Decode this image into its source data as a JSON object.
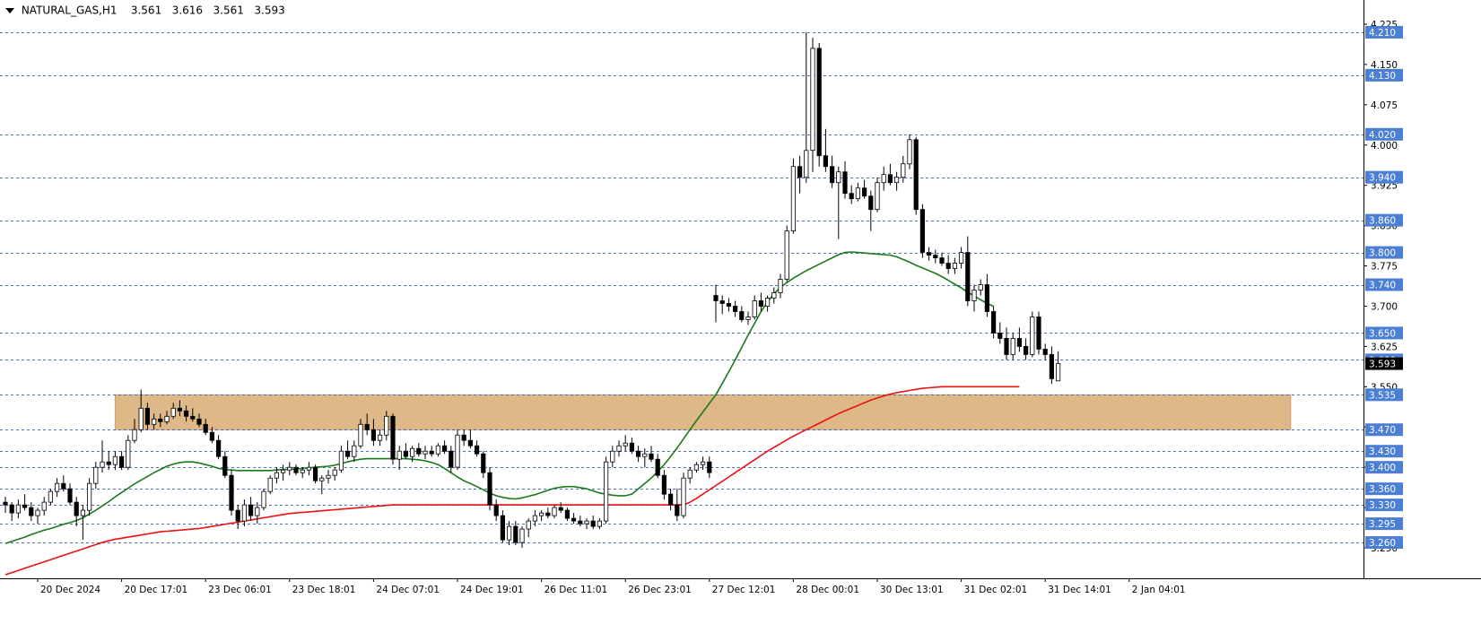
{
  "header": {
    "symbol": "NATURAL_GAS,H1",
    "open": "3.561",
    "high": "3.616",
    "low": "3.561",
    "close": "3.593"
  },
  "chart_data": {
    "type": "candlestick",
    "y_range": [
      3.215,
      4.245
    ],
    "price_axis_ticks": [
      4.225,
      4.15,
      4.075,
      4.0,
      3.925,
      3.85,
      3.775,
      3.7,
      3.625,
      3.55,
      3.475,
      3.4,
      3.325,
      3.25
    ],
    "horizontal_levels": [
      {
        "value": 4.21,
        "label": "4.210"
      },
      {
        "value": 4.13,
        "label": "4.130"
      },
      {
        "value": 4.02,
        "label": "4.020"
      },
      {
        "value": 3.94,
        "label": "3.940"
      },
      {
        "value": 3.86,
        "label": "3.860"
      },
      {
        "value": 3.8,
        "label": "3.800"
      },
      {
        "value": 3.74,
        "label": "3.740"
      },
      {
        "value": 3.65,
        "label": "3.650"
      },
      {
        "value": 3.6,
        "label": "3.600"
      },
      {
        "value": 3.535,
        "label": "3.535"
      },
      {
        "value": 3.47,
        "label": "3.470"
      },
      {
        "value": 3.43,
        "label": "3.430"
      },
      {
        "value": 3.4,
        "label": "3.400"
      },
      {
        "value": 3.36,
        "label": "3.360"
      },
      {
        "value": 3.33,
        "label": "3.330"
      },
      {
        "value": 3.295,
        "label": "3.295"
      },
      {
        "value": 3.26,
        "label": "3.260"
      }
    ],
    "current_price": {
      "value": 3.593,
      "label": "3.593"
    },
    "zone": {
      "low": 3.47,
      "high": 3.535,
      "start_bar": 17,
      "end_bar": 199,
      "color": "#deb887"
    },
    "time_labels": [
      {
        "bar": 5,
        "label": "20 Dec 2024"
      },
      {
        "bar": 18,
        "label": "20 Dec 17:01"
      },
      {
        "bar": 31,
        "label": "23 Dec 06:01"
      },
      {
        "bar": 44,
        "label": "23 Dec 18:01"
      },
      {
        "bar": 57,
        "label": "24 Dec 07:01"
      },
      {
        "bar": 70,
        "label": "24 Dec 19:01"
      },
      {
        "bar": 83,
        "label": "26 Dec 11:01"
      },
      {
        "bar": 96,
        "label": "26 Dec 23:01"
      },
      {
        "bar": 109,
        "label": "27 Dec 12:01"
      },
      {
        "bar": 122,
        "label": "28 Dec 00:01"
      },
      {
        "bar": 135,
        "label": "30 Dec 13:01"
      },
      {
        "bar": 148,
        "label": "31 Dec 02:01"
      },
      {
        "bar": 161,
        "label": "31 Dec 14:01"
      },
      {
        "bar": 174,
        "label": "2 Jan 04:01"
      }
    ],
    "ohlc": [
      [
        3.335,
        3.345,
        3.315,
        3.33
      ],
      [
        3.33,
        3.335,
        3.3,
        3.315
      ],
      [
        3.315,
        3.34,
        3.305,
        3.33
      ],
      [
        3.33,
        3.35,
        3.32,
        3.325
      ],
      [
        3.325,
        3.335,
        3.3,
        3.31
      ],
      [
        3.31,
        3.325,
        3.295,
        3.32
      ],
      [
        3.32,
        3.345,
        3.31,
        3.335
      ],
      [
        3.335,
        3.36,
        3.33,
        3.355
      ],
      [
        3.355,
        3.38,
        3.345,
        3.37
      ],
      [
        3.37,
        3.385,
        3.355,
        3.36
      ],
      [
        3.36,
        3.37,
        3.33,
        3.335
      ],
      [
        3.335,
        3.345,
        3.29,
        3.31
      ],
      [
        3.31,
        3.33,
        3.265,
        3.32
      ],
      [
        3.32,
        3.38,
        3.31,
        3.37
      ],
      [
        3.37,
        3.41,
        3.36,
        3.4
      ],
      [
        3.4,
        3.45,
        3.39,
        3.41
      ],
      [
        3.41,
        3.43,
        3.395,
        3.405
      ],
      [
        3.405,
        3.43,
        3.395,
        3.42
      ],
      [
        3.42,
        3.43,
        3.395,
        3.4
      ],
      [
        3.4,
        3.46,
        3.395,
        3.45
      ],
      [
        3.45,
        3.49,
        3.445,
        3.47
      ],
      [
        3.47,
        3.545,
        3.465,
        3.51
      ],
      [
        3.51,
        3.52,
        3.47,
        3.48
      ],
      [
        3.48,
        3.5,
        3.47,
        3.49
      ],
      [
        3.49,
        3.5,
        3.475,
        3.485
      ],
      [
        3.485,
        3.505,
        3.48,
        3.495
      ],
      [
        3.495,
        3.52,
        3.49,
        3.51
      ],
      [
        3.51,
        3.525,
        3.495,
        3.505
      ],
      [
        3.505,
        3.515,
        3.485,
        3.495
      ],
      [
        3.495,
        3.51,
        3.485,
        3.49
      ],
      [
        3.49,
        3.5,
        3.475,
        3.48
      ],
      [
        3.48,
        3.49,
        3.46,
        3.465
      ],
      [
        3.465,
        3.475,
        3.445,
        3.45
      ],
      [
        3.45,
        3.46,
        3.415,
        3.42
      ],
      [
        3.42,
        3.43,
        3.38,
        3.385
      ],
      [
        3.385,
        3.395,
        3.31,
        3.32
      ],
      [
        3.32,
        3.33,
        3.285,
        3.3
      ],
      [
        3.3,
        3.34,
        3.29,
        3.33
      ],
      [
        3.33,
        3.345,
        3.3,
        3.31
      ],
      [
        3.31,
        3.335,
        3.295,
        3.325
      ],
      [
        3.325,
        3.36,
        3.32,
        3.355
      ],
      [
        3.355,
        3.385,
        3.35,
        3.38
      ],
      [
        3.38,
        3.4,
        3.37,
        3.39
      ],
      [
        3.39,
        3.405,
        3.375,
        3.395
      ],
      [
        3.395,
        3.41,
        3.385,
        3.4
      ],
      [
        3.4,
        3.405,
        3.385,
        3.39
      ],
      [
        3.39,
        3.4,
        3.38,
        3.395
      ],
      [
        3.395,
        3.41,
        3.385,
        3.4
      ],
      [
        3.4,
        3.405,
        3.37,
        3.375
      ],
      [
        3.375,
        3.385,
        3.35,
        3.38
      ],
      [
        3.38,
        3.395,
        3.37,
        3.385
      ],
      [
        3.385,
        3.4,
        3.375,
        3.395
      ],
      [
        3.395,
        3.44,
        3.39,
        3.43
      ],
      [
        3.43,
        3.45,
        3.415,
        3.42
      ],
      [
        3.42,
        3.45,
        3.41,
        3.44
      ],
      [
        3.44,
        3.49,
        3.435,
        3.48
      ],
      [
        3.48,
        3.5,
        3.46,
        3.47
      ],
      [
        3.47,
        3.49,
        3.44,
        3.45
      ],
      [
        3.45,
        3.47,
        3.44,
        3.46
      ],
      [
        3.46,
        3.505,
        3.45,
        3.495
      ],
      [
        3.495,
        3.5,
        3.405,
        3.415
      ],
      [
        3.415,
        3.44,
        3.395,
        3.43
      ],
      [
        3.43,
        3.445,
        3.415,
        3.42
      ],
      [
        3.42,
        3.44,
        3.41,
        3.435
      ],
      [
        3.435,
        3.445,
        3.42,
        3.425
      ],
      [
        3.425,
        3.44,
        3.415,
        3.43
      ],
      [
        3.43,
        3.44,
        3.42,
        3.425
      ],
      [
        3.425,
        3.445,
        3.42,
        3.44
      ],
      [
        3.44,
        3.45,
        3.425,
        3.43
      ],
      [
        3.43,
        3.44,
        3.39,
        3.4
      ],
      [
        3.4,
        3.47,
        3.395,
        3.46
      ],
      [
        3.46,
        3.47,
        3.44,
        3.45
      ],
      [
        3.45,
        3.47,
        3.435,
        3.44
      ],
      [
        3.44,
        3.45,
        3.42,
        3.425
      ],
      [
        3.425,
        3.43,
        3.38,
        3.39
      ],
      [
        3.39,
        3.4,
        3.32,
        3.33
      ],
      [
        3.33,
        3.34,
        3.3,
        3.31
      ],
      [
        3.31,
        3.32,
        3.26,
        3.265
      ],
      [
        3.265,
        3.3,
        3.255,
        3.29
      ],
      [
        3.29,
        3.3,
        3.255,
        3.26
      ],
      [
        3.26,
        3.29,
        3.25,
        3.285
      ],
      [
        3.285,
        3.305,
        3.27,
        3.3
      ],
      [
        3.3,
        3.32,
        3.29,
        3.31
      ],
      [
        3.31,
        3.32,
        3.3,
        3.315
      ],
      [
        3.315,
        3.325,
        3.305,
        3.31
      ],
      [
        3.31,
        3.33,
        3.305,
        3.325
      ],
      [
        3.325,
        3.335,
        3.315,
        3.32
      ],
      [
        3.32,
        3.325,
        3.3,
        3.305
      ],
      [
        3.305,
        3.315,
        3.295,
        3.3
      ],
      [
        3.3,
        3.31,
        3.29,
        3.295
      ],
      [
        3.295,
        3.305,
        3.285,
        3.3
      ],
      [
        3.3,
        3.31,
        3.285,
        3.29
      ],
      [
        3.29,
        3.305,
        3.285,
        3.3
      ],
      [
        3.3,
        3.42,
        3.295,
        3.41
      ],
      [
        3.41,
        3.44,
        3.4,
        3.43
      ],
      [
        3.43,
        3.45,
        3.42,
        3.44
      ],
      [
        3.44,
        3.46,
        3.43,
        3.445
      ],
      [
        3.445,
        3.455,
        3.425,
        3.43
      ],
      [
        3.43,
        3.44,
        3.41,
        3.42
      ],
      [
        3.42,
        3.435,
        3.4,
        3.425
      ],
      [
        3.425,
        3.44,
        3.41,
        3.415
      ],
      [
        3.415,
        3.425,
        3.38,
        3.385
      ],
      [
        3.385,
        3.395,
        3.34,
        3.35
      ],
      [
        3.35,
        3.36,
        3.32,
        3.33
      ],
      [
        3.33,
        3.36,
        3.3,
        3.31
      ],
      [
        3.31,
        3.39,
        3.305,
        3.38
      ],
      [
        3.38,
        3.4,
        3.37,
        3.395
      ],
      [
        3.395,
        3.41,
        3.39,
        3.405
      ],
      [
        3.405,
        3.42,
        3.395,
        3.41
      ],
      [
        3.41,
        3.42,
        3.38,
        3.39
      ],
      [
        3.72,
        3.74,
        3.67,
        3.71
      ],
      [
        3.71,
        3.72,
        3.685,
        3.705
      ],
      [
        3.705,
        3.715,
        3.69,
        3.7
      ],
      [
        3.7,
        3.71,
        3.68,
        3.69
      ],
      [
        3.69,
        3.7,
        3.67,
        3.675
      ],
      [
        3.675,
        3.69,
        3.665,
        3.68
      ],
      [
        3.68,
        3.72,
        3.675,
        3.71
      ],
      [
        3.71,
        3.725,
        3.69,
        3.7
      ],
      [
        3.7,
        3.72,
        3.69,
        3.715
      ],
      [
        3.715,
        3.735,
        3.705,
        3.725
      ],
      [
        3.725,
        3.76,
        3.715,
        3.75
      ],
      [
        3.75,
        3.85,
        3.745,
        3.84
      ],
      [
        3.84,
        3.975,
        3.835,
        3.96
      ],
      [
        3.96,
        3.98,
        3.91,
        3.94
      ],
      [
        3.94,
        4.21,
        3.93,
        3.99
      ],
      [
        3.99,
        4.2,
        3.95,
        4.18
      ],
      [
        4.18,
        4.19,
        3.96,
        3.98
      ],
      [
        3.98,
        4.03,
        3.95,
        3.96
      ],
      [
        3.96,
        3.98,
        3.92,
        3.93
      ],
      [
        3.93,
        3.96,
        3.825,
        3.95
      ],
      [
        3.95,
        3.97,
        3.9,
        3.91
      ],
      [
        3.91,
        3.925,
        3.89,
        3.9
      ],
      [
        3.9,
        3.93,
        3.895,
        3.92
      ],
      [
        3.92,
        3.935,
        3.9,
        3.905
      ],
      [
        3.905,
        3.915,
        3.84,
        3.88
      ],
      [
        3.88,
        3.94,
        3.875,
        3.93
      ],
      [
        3.93,
        3.96,
        3.915,
        3.945
      ],
      [
        3.945,
        3.965,
        3.925,
        3.93
      ],
      [
        3.93,
        3.95,
        3.915,
        3.94
      ],
      [
        3.94,
        3.98,
        3.93,
        3.965
      ],
      [
        3.965,
        4.02,
        3.955,
        4.01
      ],
      [
        4.01,
        4.015,
        3.87,
        3.88
      ],
      [
        3.88,
        3.89,
        3.79,
        3.8
      ],
      [
        3.8,
        3.81,
        3.785,
        3.795
      ],
      [
        3.795,
        3.805,
        3.78,
        3.79
      ],
      [
        3.79,
        3.8,
        3.775,
        3.78
      ],
      [
        3.78,
        3.795,
        3.76,
        3.77
      ],
      [
        3.77,
        3.79,
        3.76,
        3.78
      ],
      [
        3.78,
        3.81,
        3.77,
        3.8
      ],
      [
        3.8,
        3.83,
        3.7,
        3.71
      ],
      [
        3.71,
        3.74,
        3.69,
        3.73
      ],
      [
        3.73,
        3.75,
        3.72,
        3.74
      ],
      [
        3.74,
        3.76,
        3.68,
        3.69
      ],
      [
        3.69,
        3.7,
        3.64,
        3.65
      ],
      [
        3.65,
        3.67,
        3.63,
        3.64
      ],
      [
        3.64,
        3.66,
        3.6,
        3.61
      ],
      [
        3.61,
        3.65,
        3.6,
        3.64
      ],
      [
        3.64,
        3.66,
        3.615,
        3.625
      ],
      [
        3.625,
        3.64,
        3.6,
        3.61
      ],
      [
        3.61,
        3.69,
        3.605,
        3.68
      ],
      [
        3.68,
        3.69,
        3.61,
        3.62
      ],
      [
        3.62,
        3.63,
        3.6,
        3.61
      ],
      [
        3.61,
        3.625,
        3.555,
        3.565
      ],
      [
        3.561,
        3.616,
        3.561,
        3.593
      ]
    ],
    "green_ma": [
      3.258,
      3.262,
      3.266,
      3.27,
      3.275,
      3.279,
      3.283,
      3.286,
      3.29,
      3.294,
      3.297,
      3.301,
      3.306,
      3.313,
      3.32,
      3.328,
      3.336,
      3.345,
      3.353,
      3.361,
      3.369,
      3.376,
      3.383,
      3.39,
      3.396,
      3.402,
      3.406,
      3.409,
      3.41,
      3.41,
      3.408,
      3.405,
      3.402,
      3.398,
      3.396,
      3.395,
      3.394,
      3.394,
      3.394,
      3.394,
      3.394,
      3.394,
      3.395,
      3.396,
      3.396,
      3.397,
      3.398,
      3.399,
      3.4,
      3.401,
      3.402,
      3.404,
      3.407,
      3.41,
      3.413,
      3.415,
      3.416,
      3.416,
      3.416,
      3.416,
      3.416,
      3.416,
      3.416,
      3.415,
      3.414,
      3.412,
      3.409,
      3.405,
      3.398,
      3.39,
      3.382,
      3.375,
      3.37,
      3.364,
      3.358,
      3.352,
      3.347,
      3.344,
      3.342,
      3.341,
      3.343,
      3.346,
      3.349,
      3.353,
      3.357,
      3.361,
      3.363,
      3.364,
      3.364,
      3.362,
      3.36,
      3.356,
      3.352,
      3.35,
      3.348,
      3.347,
      3.347,
      3.35,
      3.36,
      3.37,
      3.38,
      3.392,
      3.405,
      3.42,
      3.436,
      3.453,
      3.47,
      3.487,
      3.503,
      3.519,
      3.535,
      3.556,
      3.578,
      3.6,
      3.623,
      3.646,
      3.668,
      3.69,
      3.708,
      3.723,
      3.735,
      3.744,
      3.752,
      3.759,
      3.766,
      3.772,
      3.778,
      3.784,
      3.79,
      3.796,
      3.8,
      3.801,
      3.8,
      3.799,
      3.798,
      3.797,
      3.796,
      3.795,
      3.792,
      3.787,
      3.782,
      3.776,
      3.771,
      3.766,
      3.761,
      3.755,
      3.748,
      3.741,
      3.734,
      3.726,
      3.719,
      3.712,
      3.705,
      3.7
    ],
    "red_ma": [
      3.2,
      3.204,
      3.208,
      3.212,
      3.216,
      3.22,
      3.224,
      3.228,
      3.232,
      3.236,
      3.24,
      3.244,
      3.248,
      3.252,
      3.256,
      3.26,
      3.263,
      3.266,
      3.268,
      3.27,
      3.272,
      3.274,
      3.276,
      3.278,
      3.28,
      3.281,
      3.282,
      3.283,
      3.284,
      3.285,
      3.286,
      3.288,
      3.29,
      3.292,
      3.294,
      3.296,
      3.298,
      3.3,
      3.302,
      3.304,
      3.306,
      3.308,
      3.31,
      3.312,
      3.314,
      3.315,
      3.316,
      3.317,
      3.318,
      3.319,
      3.32,
      3.321,
      3.322,
      3.323,
      3.324,
      3.325,
      3.326,
      3.327,
      3.328,
      3.329,
      3.33,
      3.33,
      3.33,
      3.33,
      3.33,
      3.33,
      3.33,
      3.33,
      3.33,
      3.33,
      3.33,
      3.33,
      3.33,
      3.33,
      3.33,
      3.33,
      3.33,
      3.33,
      3.33,
      3.33,
      3.33,
      3.33,
      3.33,
      3.33,
      3.33,
      3.33,
      3.33,
      3.33,
      3.33,
      3.33,
      3.33,
      3.33,
      3.33,
      3.33,
      3.33,
      3.33,
      3.33,
      3.33,
      3.33,
      3.33,
      3.33,
      3.33,
      3.33,
      3.33,
      3.33,
      3.33,
      3.335,
      3.342,
      3.35,
      3.358,
      3.366,
      3.374,
      3.382,
      3.39,
      3.398,
      3.406,
      3.414,
      3.422,
      3.43,
      3.437,
      3.444,
      3.451,
      3.458,
      3.464,
      3.47,
      3.476,
      3.482,
      3.488,
      3.494,
      3.5,
      3.505,
      3.51,
      3.515,
      3.52,
      3.525,
      3.529,
      3.533,
      3.536,
      3.539,
      3.541,
      3.543,
      3.545,
      3.547,
      3.548,
      3.549,
      3.55,
      3.55,
      3.55,
      3.55,
      3.55,
      3.55,
      3.55,
      3.55,
      3.55,
      3.55,
      3.55,
      3.55,
      3.55
    ],
    "colors": {
      "level_line": "#4a6fbf",
      "label_bg": "#4a7fd4",
      "label_text": "#ffffff",
      "zone_fill": "#deb887",
      "green_ma": "#1a7a1a",
      "red_ma": "#ee1111",
      "candle_up_fill": "#ffffff",
      "candle_down_fill": "#000000",
      "candle_line": "#000000",
      "current_price_bg": "#000000",
      "current_price_text": "#ffffff",
      "axis": "#000000",
      "text": "#000000"
    }
  }
}
